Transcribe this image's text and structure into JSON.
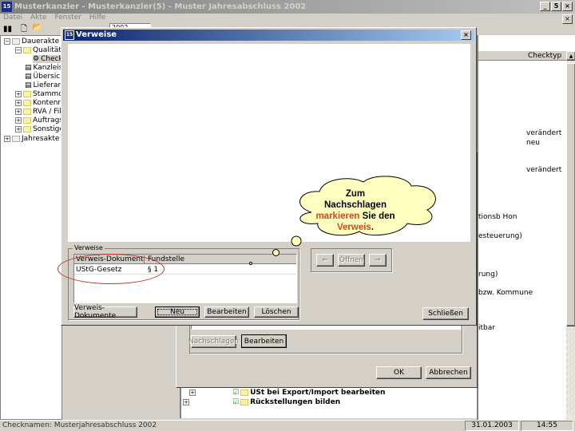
{
  "app": {
    "title": "Musterkanzler - Musterkanzler(5) - Muster Jahresabschluss 2002",
    "menu": [
      "Datei",
      "Akte",
      "Fenster",
      "Hilfe"
    ],
    "toolbar_combo": "2002"
  },
  "tree": [
    {
      "label": "Dauerakte",
      "expanded": true
    },
    {
      "label": "Qualitäts",
      "expanded": true
    },
    {
      "label": "Checkl",
      "selected": true
    },
    {
      "label": "Kanzleista"
    },
    {
      "label": "Übersicht"
    },
    {
      "label": "Lieferante"
    },
    {
      "label": "Stammdat"
    },
    {
      "label": "Kontenrah"
    },
    {
      "label": "RVA / Fil"
    },
    {
      "label": "Auftragsw"
    },
    {
      "label": "Sonstiges"
    },
    {
      "label": "Jahresakte"
    }
  ],
  "right": {
    "column_header": "Checktyp",
    "values": [
      "verändert",
      "neu",
      "verändert",
      "tionsb Hon",
      "esteuerung)",
      "rung)",
      "bzw. Kommune",
      "itbar"
    ]
  },
  "back_dialog": {
    "lookup_button": "Nachschlagen",
    "edit_button": "Bearbeiten",
    "ok_button": "OK",
    "cancel_button": "Abbrechen",
    "tree_rows": [
      "USt bei Export/Import bearbeiten",
      "Rückstellungen bilden"
    ]
  },
  "dialog": {
    "title": "Verweise",
    "close": "×",
    "group_label": "Verweise",
    "columns": [
      "Verweis-Dokument",
      "Fundstelle"
    ],
    "rows": [
      [
        "UStG-Gesetz",
        "§ 1"
      ]
    ],
    "buttons": {
      "documents": "Verweis-Dokumente",
      "new": "Neu",
      "edit": "Bearbeiten",
      "delete": "Löschen",
      "back": "⇐",
      "open": "Öffnen",
      "forward": "⇒",
      "close": "Schließen"
    }
  },
  "callout": {
    "line1": "Zum",
    "line2": "Nachschlagen",
    "highlight1": "markieren",
    "mid": " Sie den",
    "highlight2": "Verweis",
    "end": ".",
    "highlight_color": "#d2481e",
    "fill": "#ffffc0"
  },
  "status": {
    "text": "Checknamen: Musterjahresabschluss 2002",
    "date": "31.01.2003",
    "time": "14:55"
  }
}
